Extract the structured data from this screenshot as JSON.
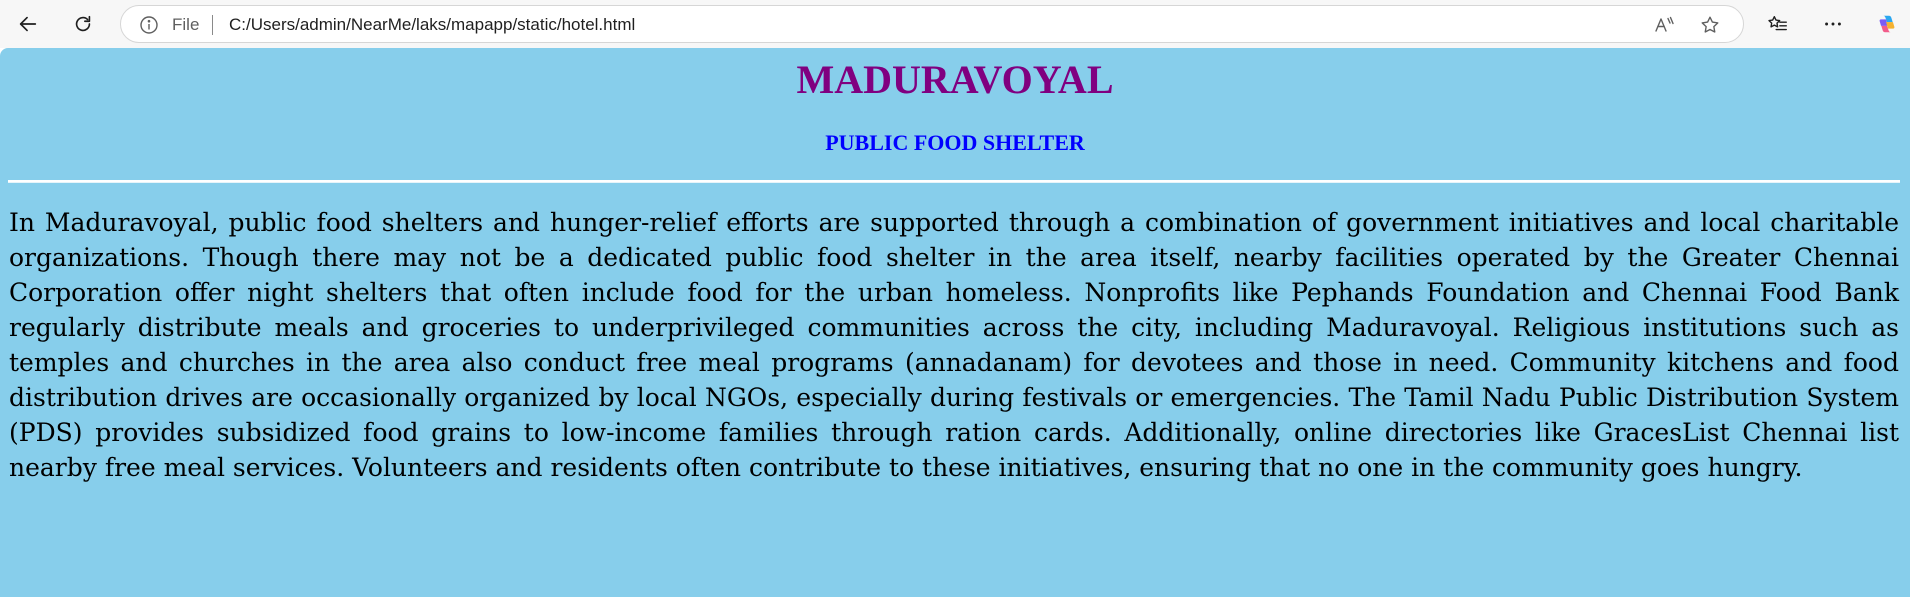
{
  "browser": {
    "scheme_label": "File",
    "url": "C:/Users/admin/NearMe/laks/mapapp/static/hotel.html"
  },
  "page": {
    "title": "MADURAVOYAL",
    "subtitle": "PUBLIC FOOD SHELTER",
    "description": "In Maduravoyal, public food shelters and hunger-relief efforts are supported through a combination of government initiatives and local charitable organizations. Though there may not be a dedicated public food shelter in the area itself, nearby facilities operated by the Greater Chennai Corporation offer night shelters that often include food for the urban homeless. Nonprofits like Pephands Foundation and Chennai Food Bank regularly distribute meals and groceries to underprivileged communities across the city, including Maduravoyal. Religious institutions such as temples and churches in the area also conduct free meal programs (annadanam) for devotees and those in need. Community kitchens and food distribution drives are occasionally organized by local NGOs, especially during festivals or emergencies. The Tamil Nadu Public Distribution System (PDS) provides subsidized food grains to low-income families through ration cards. Additionally, online directories like GracesList Chennai list nearby free meal services. Volunteers and residents often contribute to these initiatives, ensuring that no one in the community goes hungry."
  },
  "colors": {
    "page_background": "#87ceeb",
    "title": "#800080",
    "subtitle": "#0000ff",
    "divider": "#ffffff"
  },
  "icons": [
    "back-arrow-icon",
    "reload-icon",
    "info-icon",
    "read-aloud-icon",
    "favorite-star-icon",
    "favorites-icon",
    "more-icon",
    "copilot-icon"
  ]
}
